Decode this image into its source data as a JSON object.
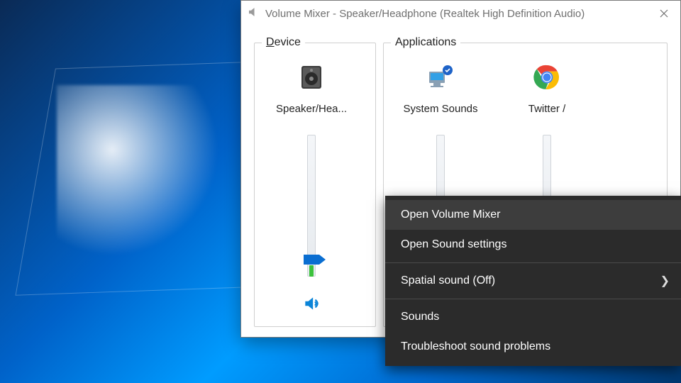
{
  "window": {
    "title": "Volume Mixer - Speaker/Headphone (Realtek High Definition Audio)"
  },
  "groups": {
    "device_label": "Device",
    "applications_label": "Applications"
  },
  "channels": {
    "device": {
      "label": "Speaker/Hea...",
      "icon": "speaker-device",
      "volume_percent": 12,
      "meter_percent": 8,
      "muted": false
    },
    "apps": [
      {
        "label": "System Sounds",
        "icon": "system-sounds",
        "volume_percent": 12,
        "meter_percent": 0,
        "muted": false
      },
      {
        "label": "Twitter /",
        "icon": "chrome",
        "volume_percent": 12,
        "meter_percent": 0,
        "muted": false
      }
    ]
  },
  "context_menu": {
    "items": [
      {
        "label": "Open Volume Mixer",
        "highlighted": true,
        "has_submenu": false
      },
      {
        "label": "Open Sound settings",
        "highlighted": false,
        "has_submenu": false
      },
      {
        "separator": true
      },
      {
        "label": "Spatial sound (Off)",
        "highlighted": false,
        "has_submenu": true
      },
      {
        "separator": true
      },
      {
        "label": "Sounds",
        "highlighted": false,
        "has_submenu": false
      },
      {
        "label": "Troubleshoot sound problems",
        "highlighted": false,
        "has_submenu": false
      }
    ]
  }
}
